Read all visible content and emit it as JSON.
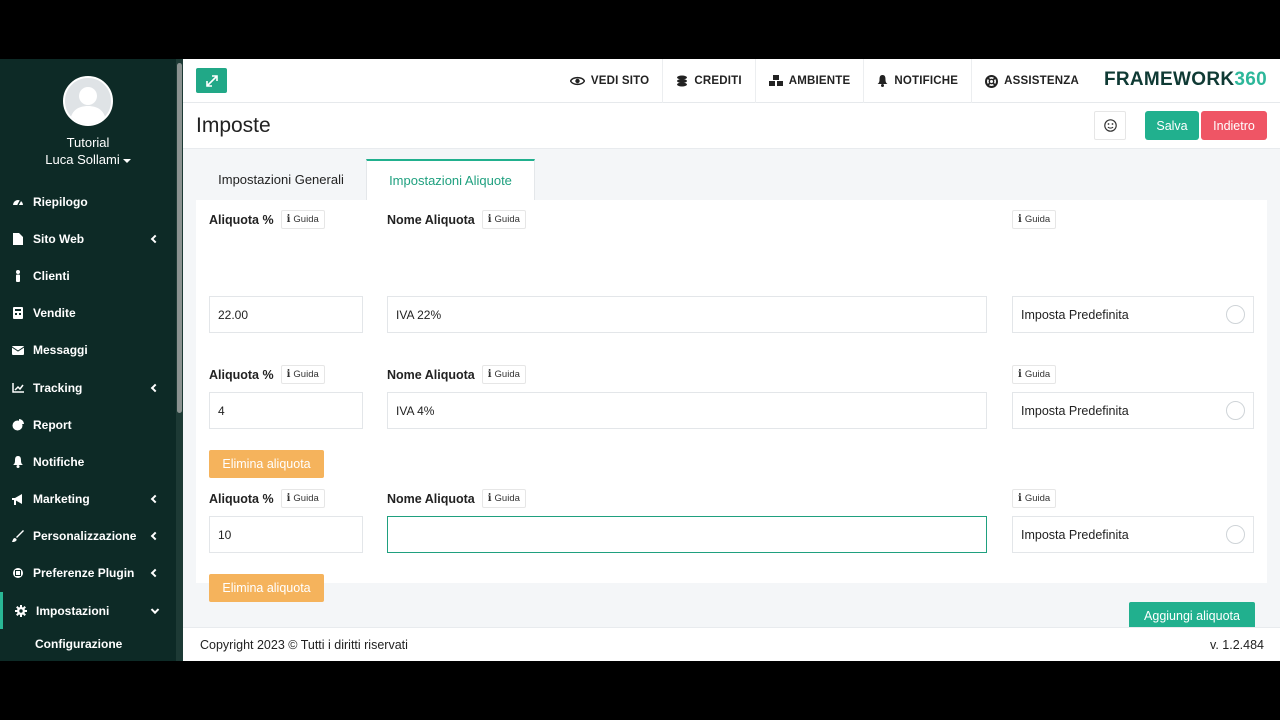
{
  "sidebar": {
    "user_role": "Tutorial",
    "user_name": "Luca Sollami",
    "items": [
      {
        "label": "Riepilogo",
        "icon": "dashboard-icon"
      },
      {
        "label": "Sito Web",
        "icon": "file-icon"
      },
      {
        "label": "Clienti",
        "icon": "person-icon"
      },
      {
        "label": "Vendite",
        "icon": "calculator-icon"
      },
      {
        "label": "Messaggi",
        "icon": "envelope-icon"
      },
      {
        "label": "Tracking",
        "icon": "line-chart-icon"
      },
      {
        "label": "Report",
        "icon": "pie-chart-icon"
      },
      {
        "label": "Notifiche",
        "icon": "bell-icon"
      },
      {
        "label": "Marketing",
        "icon": "megaphone-icon"
      },
      {
        "label": "Personalizzazione",
        "icon": "brush-icon"
      },
      {
        "label": "Preferenze Plugin",
        "icon": "plug-icon"
      },
      {
        "label": "Impostazioni",
        "icon": "gear-icon"
      }
    ],
    "sub_item": "Configurazione"
  },
  "topbar": {
    "vedi_sito": "VEDI SITO",
    "crediti": "CREDITI",
    "ambiente": "AMBIENTE",
    "notifiche": "NOTIFICHE",
    "assistenza": "ASSISTENZA",
    "brand_text": "FRAMEWORK",
    "brand_num": "360"
  },
  "page": {
    "title": "Imposte",
    "save_label": "Salva",
    "back_label": "Indietro"
  },
  "tabs": {
    "general": "Impostazioni Generali",
    "rates": "Impostazioni Aliquote"
  },
  "form": {
    "aliquota_label": "Aliquota %",
    "nome_label": "Nome Aliquota",
    "guida": "Guida",
    "default_label": "Imposta Predefinita",
    "delete_label": "Elimina aliquota",
    "add_label": "Aggiungi aliquota",
    "rows": [
      {
        "rate": "22.00",
        "name": "IVA 22%"
      },
      {
        "rate": "4",
        "name": "IVA 4%"
      },
      {
        "rate": "10",
        "name": ""
      }
    ]
  },
  "footer": {
    "copyright": "Copyright 2023 © Tutti i diritti riservati",
    "version": "v. 1.2.484"
  },
  "colors": {
    "sidebar_bg": "#0d2a26",
    "accent": "#21b08e",
    "danger": "#ef5565",
    "warning": "#f5b35c"
  }
}
